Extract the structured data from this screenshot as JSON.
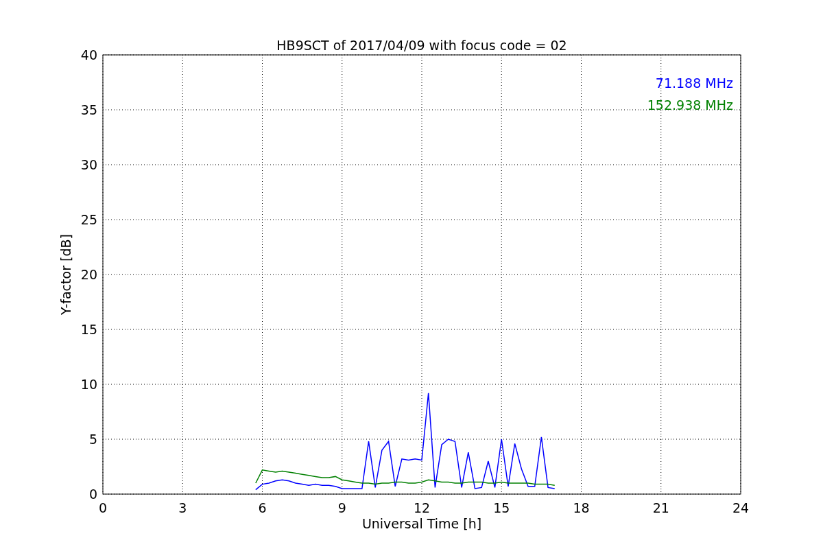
{
  "chart_data": {
    "type": "line",
    "title": "HB9SCT of 2017/04/09 with focus code = 02",
    "xlabel": "Universal Time [h]",
    "ylabel": "Y-factor [dB]",
    "xlim": [
      0,
      24
    ],
    "ylim": [
      0,
      40
    ],
    "xticks": [
      0,
      3,
      6,
      9,
      12,
      15,
      18,
      21,
      24
    ],
    "yticks": [
      0,
      5,
      10,
      15,
      20,
      25,
      30,
      35,
      40
    ],
    "grid": true,
    "x": [
      5.75,
      6,
      6.25,
      6.5,
      6.75,
      7,
      7.25,
      7.5,
      7.75,
      8,
      8.25,
      8.5,
      8.75,
      9,
      9.25,
      9.5,
      9.75,
      10,
      10.25,
      10.5,
      10.75,
      11,
      11.25,
      11.5,
      11.75,
      12,
      12.25,
      12.5,
      12.75,
      13,
      13.25,
      13.5,
      13.75,
      14,
      14.25,
      14.5,
      14.75,
      15,
      15.25,
      15.5,
      15.75,
      16,
      16.25,
      16.5,
      16.75,
      17
    ],
    "series": [
      {
        "name": "71.188 MHz",
        "color": "#0000ff",
        "values": [
          0.4,
          0.9,
          1.0,
          1.2,
          1.3,
          1.2,
          1.0,
          0.9,
          0.8,
          0.9,
          0.8,
          0.8,
          0.7,
          0.5,
          0.5,
          0.5,
          0.5,
          4.8,
          0.6,
          4.0,
          4.8,
          0.7,
          3.2,
          3.1,
          3.2,
          3.1,
          9.2,
          0.6,
          4.5,
          5.0,
          4.8,
          0.6,
          3.8,
          0.5,
          0.6,
          3.0,
          0.6,
          5.0,
          0.7,
          4.6,
          2.3,
          0.7,
          0.7,
          5.2,
          0.6,
          0.5
        ]
      },
      {
        "name": "152.938 MHz",
        "color": "#008000",
        "values": [
          1.0,
          2.2,
          2.1,
          2.0,
          2.1,
          2.0,
          1.9,
          1.8,
          1.7,
          1.6,
          1.5,
          1.5,
          1.6,
          1.3,
          1.2,
          1.1,
          1.0,
          1.0,
          0.9,
          1.0,
          1.0,
          1.1,
          1.1,
          1.0,
          1.0,
          1.1,
          1.3,
          1.2,
          1.1,
          1.1,
          1.0,
          1.0,
          1.1,
          1.1,
          1.1,
          1.0,
          1.0,
          1.1,
          1.0,
          1.0,
          1.0,
          1.0,
          0.9,
          0.9,
          0.9,
          0.8
        ]
      }
    ]
  }
}
